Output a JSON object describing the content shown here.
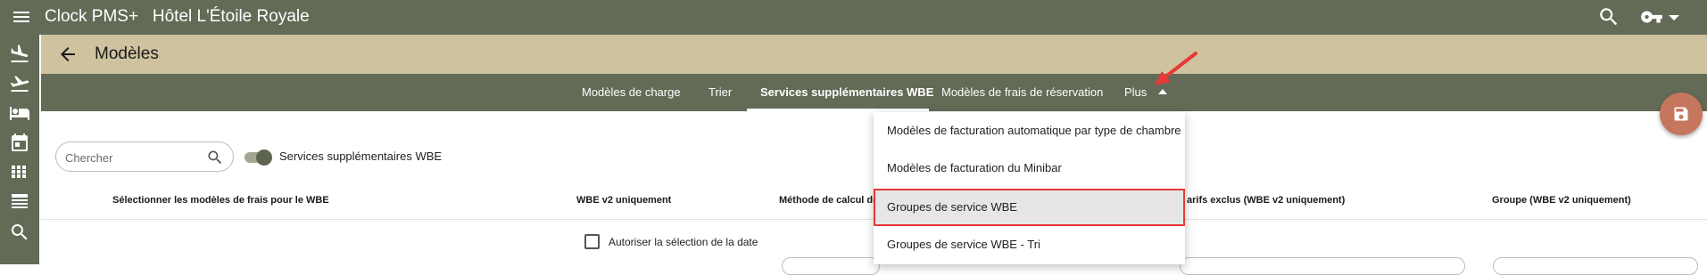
{
  "header": {
    "app_title": "Clock PMS+   Hôtel L'Étoile Royale",
    "icons": [
      "menu-icon",
      "search-icon",
      "key-icon",
      "arrow-drop-down-icon"
    ]
  },
  "sidebar": {
    "icons": [
      "flight-land-icon",
      "flight-takeoff-icon",
      "hotel-bed-icon",
      "calendar-icon",
      "grid-view-icon",
      "table-view-icon",
      "search-icon"
    ]
  },
  "subheader": {
    "title": "Modèles"
  },
  "tabs": [
    {
      "label": "Modèles de charge"
    },
    {
      "label": "Trier"
    },
    {
      "label": "Services supplémentaires WBE",
      "active": true
    },
    {
      "label": "Modèles de frais de réservation"
    },
    {
      "label": "Plus"
    }
  ],
  "dropdown_menu": {
    "items": [
      {
        "label": "Modèles de facturation automatique par type de chambre"
      },
      {
        "label": "Modèles de facturation du Minibar"
      },
      {
        "label": "Groupes de service WBE",
        "highlighted": true
      },
      {
        "label": "Groupes de service WBE - Tri"
      }
    ]
  },
  "filters": {
    "search_placeholder": "Chercher",
    "search_value": "",
    "toggle_label": "Services supplémentaires WBE",
    "toggle_on": true
  },
  "table": {
    "columns": [
      "Sélectionner les modèles de frais pour le WBE",
      "WBE v2 uniquement",
      "Méthode de calcul des",
      "arifs exclus (WBE v2 uniquement)",
      "Groupe (WBE v2 uniquement)"
    ],
    "row1": {
      "checkbox_label": "Autoriser la sélection de la date",
      "checked": false
    }
  },
  "colors": {
    "header_bg": "#636b56",
    "subheader_bg": "#cfc29f",
    "fab_bg": "#c7765e",
    "highlight_border": "#e53935",
    "annotation_arrow": "#e53935"
  }
}
